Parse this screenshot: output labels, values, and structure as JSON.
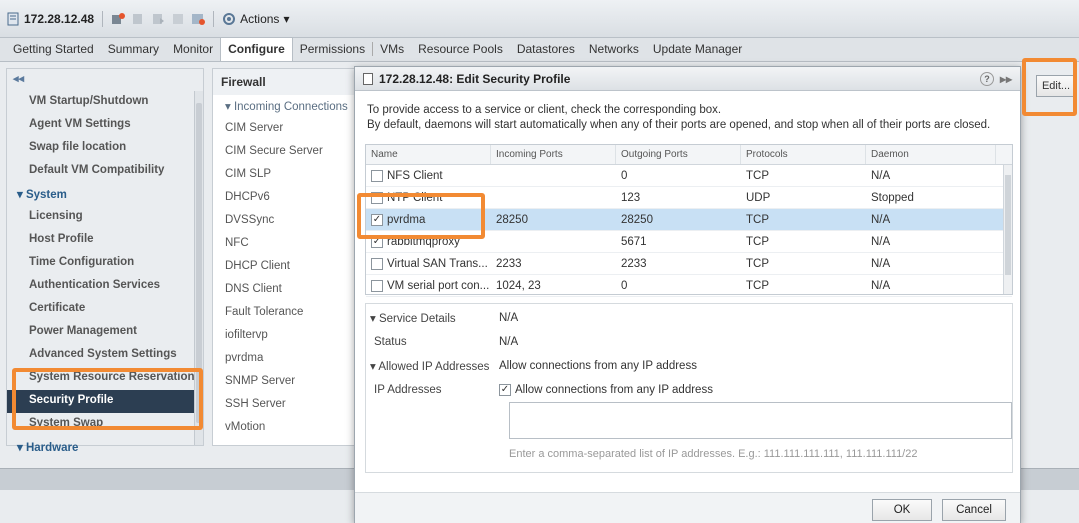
{
  "toolbar": {
    "host": "172.28.12.48",
    "actions_label": "Actions"
  },
  "tabs": [
    "Getting Started",
    "Summary",
    "Monitor",
    "Configure",
    "Permissions",
    "VMs",
    "Resource Pools",
    "Datastores",
    "Networks",
    "Update Manager"
  ],
  "leftnav": {
    "items": [
      "VM Startup/Shutdown",
      "Agent VM Settings",
      "Swap file location",
      "Default VM Compatibility",
      "System",
      "Licensing",
      "Host Profile",
      "Time Configuration",
      "Authentication Services",
      "Certificate",
      "Power Management",
      "Advanced System Settings",
      "System Resource Reservation",
      "Security Profile",
      "System Swap",
      "Hardware"
    ]
  },
  "firewall": {
    "title": "Firewall",
    "items": [
      "Incoming Connections",
      "CIM Server",
      "CIM Secure Server",
      "CIM SLP",
      "DHCPv6",
      "DVSSync",
      "NFC",
      "DHCP Client",
      "DNS Client",
      "Fault Tolerance",
      "iofiltervp",
      "pvrdma",
      "SNMP Server",
      "SSH Server",
      "vMotion"
    ]
  },
  "edit_label": "Edit...",
  "dialog": {
    "title": "172.28.12.48: Edit Security Profile",
    "desc1": "To provide access to a service or client, check the corresponding box.",
    "desc2": "By default, daemons will start automatically when any of their ports are opened, and stop when all of their ports are closed.",
    "columns": [
      "Name",
      "Incoming Ports",
      "Outgoing Ports",
      "Protocols",
      "Daemon"
    ],
    "rows": [
      {
        "name": "NFS Client",
        "in": "",
        "out": "0",
        "proto": "TCP",
        "daemon": "N/A",
        "checked": ""
      },
      {
        "name": "NTP Client",
        "in": "",
        "out": "123",
        "proto": "UDP",
        "daemon": "Stopped",
        "checked": ""
      },
      {
        "name": "pvrdma",
        "in": "28250",
        "out": "28250",
        "proto": "TCP",
        "daemon": "N/A",
        "checked": "✓"
      },
      {
        "name": "rabbitmqproxy",
        "in": "",
        "out": "5671",
        "proto": "TCP",
        "daemon": "N/A",
        "checked": "✓"
      },
      {
        "name": "Virtual SAN Trans...",
        "in": "2233",
        "out": "2233",
        "proto": "TCP",
        "daemon": "N/A",
        "checked": ""
      },
      {
        "name": "VM serial port con...",
        "in": "1024, 23",
        "out": "0",
        "proto": "TCP",
        "daemon": "N/A",
        "checked": ""
      }
    ],
    "details": {
      "service_details_label": "Service Details",
      "service_details_value": "N/A",
      "status_label": "Status",
      "status_value": "N/A",
      "allowed_ip_label": "Allowed IP Addresses",
      "allowed_ip_value": "Allow connections from any IP address",
      "ip_addresses_label": "IP Addresses",
      "allow_any_label": "Allow connections from any IP address",
      "ip_hint": "Enter a comma-separated list of IP addresses. E.g.: 111.111.111.111, 111.111.111/22"
    },
    "ok_label": "OK",
    "cancel_label": "Cancel"
  },
  "colors": {
    "accent_highlight": "#f28a33",
    "selected_nav": "#2c3e52",
    "selected_row": "#c8e0f4"
  }
}
